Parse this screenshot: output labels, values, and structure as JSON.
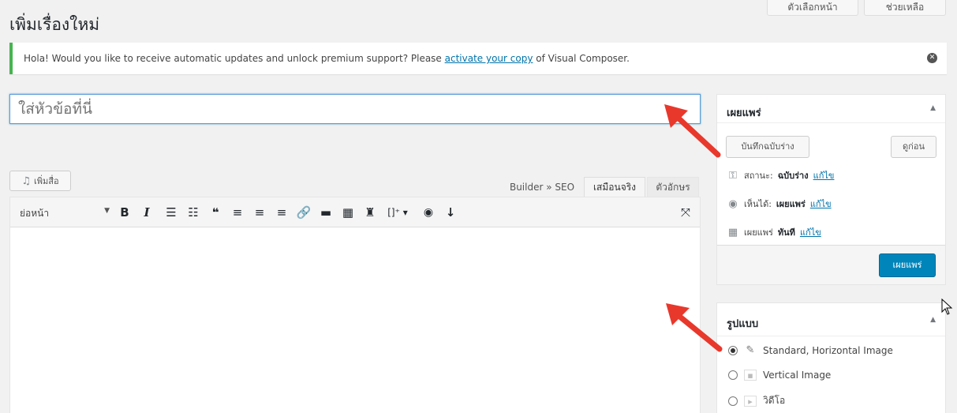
{
  "header": {
    "title": "เพิ่มเรื่องใหม่",
    "screen_options": "ตัวเลือกหน้า",
    "help": "ช่วยเหลือ"
  },
  "notice": {
    "text_before": "Hola! Would you like to receive automatic updates and unlock premium support? Please ",
    "link": "activate your copy",
    "text_after": " of Visual Composer."
  },
  "title_field": {
    "placeholder": "ใส่หัวข้อที่นี่"
  },
  "editor": {
    "add_media": "เพิ่มสื่อ",
    "tabs": [
      "Builder » SEO",
      "เสมือนจริง",
      "ตัวอักษร"
    ],
    "format_select": "ย่อหน้า"
  },
  "publish": {
    "title": "เผยแพร่",
    "save_draft": "บันทึกฉบับร่าง",
    "preview": "ดูก่อน",
    "status_label": "สถานะ:",
    "status_value": "ฉบับร่าง",
    "visibility_label": "เห็นได้:",
    "visibility_value": "เผยแพร่",
    "schedule_label": "เผยแพร่",
    "schedule_value": "ทันที",
    "edit_link": "แก้ไข",
    "publish_button": "เผยแพร่"
  },
  "format": {
    "title": "รูปแบบ",
    "options": [
      {
        "label": "Standard, Horizontal Image",
        "selected": true,
        "icon": "pin-icon"
      },
      {
        "label": "Vertical Image",
        "selected": false,
        "icon": "image-icon"
      },
      {
        "label": "วิดีโอ",
        "selected": false,
        "icon": "video-icon"
      }
    ]
  }
}
